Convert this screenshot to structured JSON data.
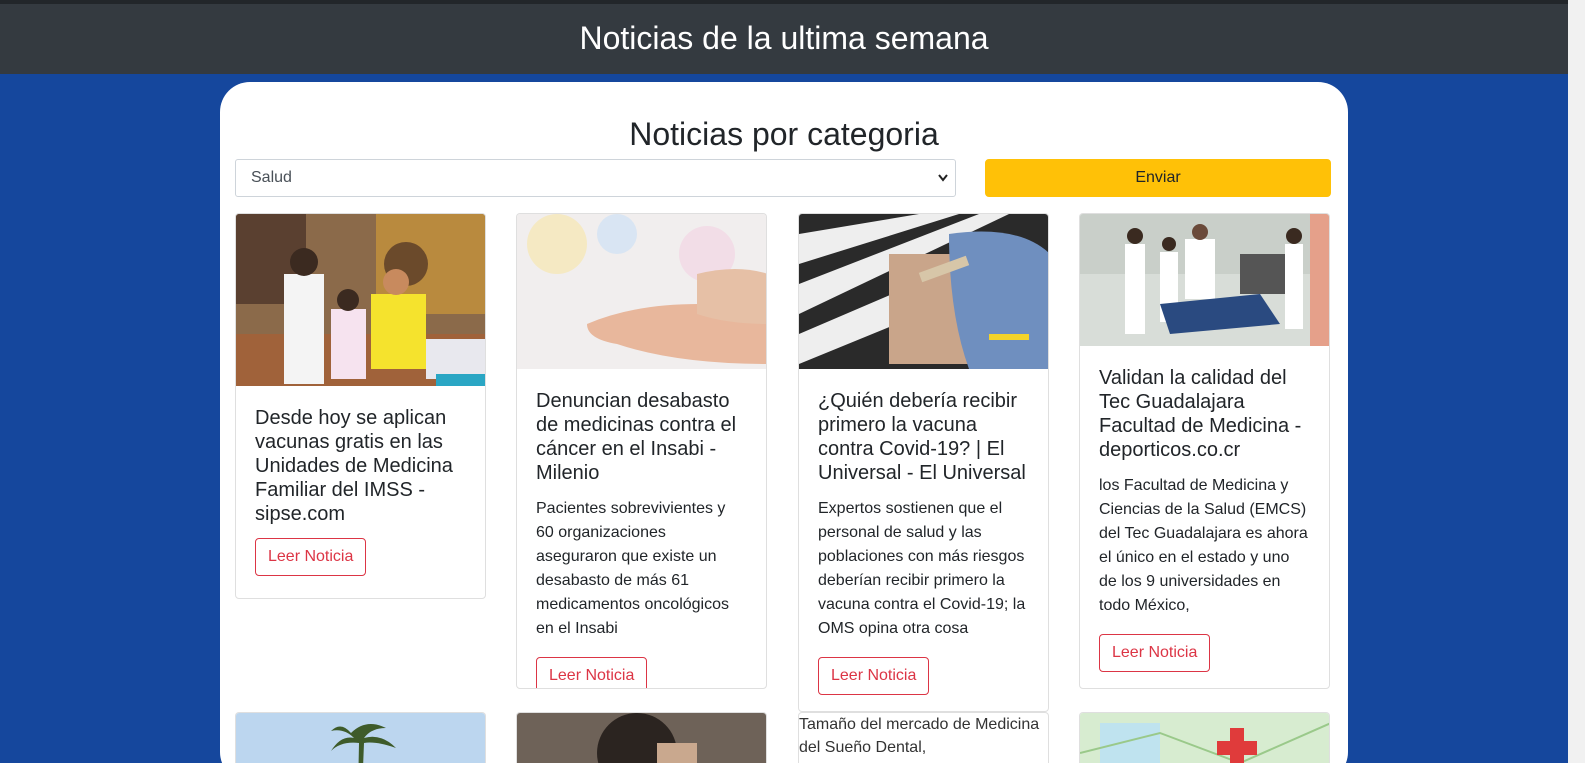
{
  "header": {
    "title": "Noticias de la ultima semana"
  },
  "panel": {
    "title": "Noticias por categoria",
    "category_select": {
      "value": "Salud"
    },
    "submit_label": "Enviar"
  },
  "cards": [
    {
      "title": "Desde hoy se aplican vacunas gratis en las Unidades de Medicina Familiar del IMSS - sipse.com",
      "description": "",
      "button": "Leer Noticia"
    },
    {
      "title": "Denuncian desabasto de medicinas contra el cáncer en el Insabi - Milenio",
      "description": "Pacientes sobrevivientes y 60 organizaciones aseguraron que existe un desabasto de más 61 medicamentos oncológicos en el Insabi",
      "button": "Leer Noticia"
    },
    {
      "title": "¿Quién debería recibir primero la vacuna contra Covid-19? | El Universal - El Universal",
      "description": "Expertos sostienen que el personal de salud y las poblaciones con más riesgos deberían recibir primero la vacuna contra el Covid-19; la OMS opina otra cosa",
      "button": "Leer Noticia"
    },
    {
      "title": "Validan la calidad del Tec Guadalajara Facultad de Medicina - deporticos.co.cr",
      "description": "los Facultad de Medicina y Ciencias de la Salud (EMCS) del Tec Guadalajara es ahora el único en el estado y uno de los 9 universidades en todo México,",
      "button": "Leer Noticia"
    }
  ],
  "second_row": {
    "broken_image_alt": "Tamaño del mercado de Medicina del Sueño Dental,"
  }
}
